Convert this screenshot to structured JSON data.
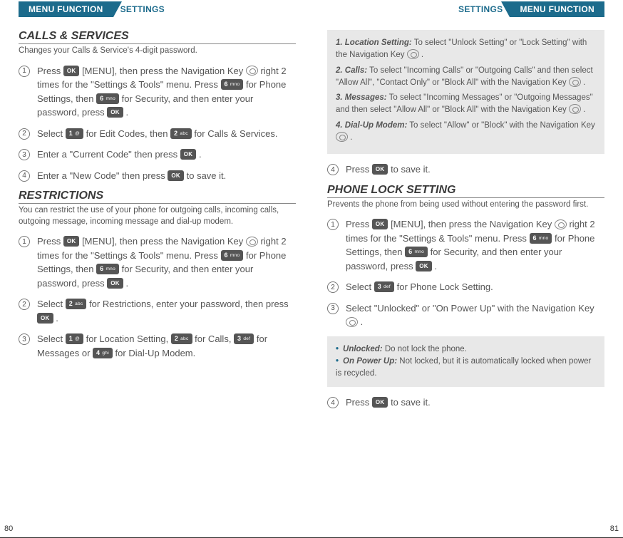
{
  "tabs": {
    "main": "MENU FUNCTION",
    "sub": "SETTINGS"
  },
  "keys": {
    "ok": "OK",
    "k1": {
      "num": "1",
      "lab": "@"
    },
    "k2": {
      "num": "2",
      "lab": "abc"
    },
    "k3": {
      "num": "3",
      "lab": "def"
    },
    "k4": {
      "num": "4",
      "lab": "ghi"
    },
    "k6": {
      "num": "6",
      "lab": "mno"
    }
  },
  "left": {
    "sec1": {
      "title": "CALLS & SERVICES",
      "subtitle": "Changes your Calls & Service's 4-digit password.",
      "steps": {
        "s1a": "Press ",
        "s1b": " [MENU], then press the Navigation Key ",
        "s1c": " right 2 times for the \"Settings & Tools\" menu. Press ",
        "s1d": " for Phone Settings, then ",
        "s1e": " for Security, and then enter your password, press ",
        "s1f": " .",
        "s2a": "Select ",
        "s2b": " for Edit Codes, then ",
        "s2c": " for Calls & Services.",
        "s3a": "Enter a \"Current Code\" then press ",
        "s3b": " .",
        "s4a": "Enter a \"New Code\" then press ",
        "s4b": " to save it."
      }
    },
    "sec2": {
      "title": "RESTRICTIONS",
      "subtitle": "You can restrict the use of your phone for outgoing calls, incoming calls, outgoing message, incoming message and dial-up modem.",
      "steps": {
        "s1a": "Press ",
        "s1b": " [MENU], then press the Navigation Key ",
        "s1c": " right 2 times for the \"Settings & Tools\" menu. Press ",
        "s1d": " for Phone Settings, then ",
        "s1e": " for Security, and then enter your password, press ",
        "s1f": " .",
        "s2a": "Select ",
        "s2b": " for Restrictions, enter your password, then press ",
        "s2c": " .",
        "s3a": "Select ",
        "s3b": " for Location Setting, ",
        "s3c": " for Calls, ",
        "s3d": " for Messages or ",
        "s3e": " for Dial-Up Modem."
      }
    },
    "pagenum": "80"
  },
  "right": {
    "box1": {
      "i1": {
        "label": "1. Location Setting:",
        "text": " To select \"Unlock Setting\" or \"Lock Setting\" with the Navigation Key ",
        "tail": " ."
      },
      "i2": {
        "label": "2. Calls:",
        "text": " To select \"Incoming Calls\" or \"Outgoing Calls\" and then select \"Allow All\", \"Contact Only\" or \"Block All\" with the Navigation Key ",
        "tail": " ."
      },
      "i3": {
        "label": "3. Messages:",
        "text": " To select \"Incoming Messages\" or \"Outgoing Messages\" and then select \"Allow All\" or \"Block All\" with the Navigation Key ",
        "tail": " ."
      },
      "i4": {
        "label": "4. Dial-Up Modem:",
        "text": " To select \"Allow\" or \"Block\" with the Navigation Key ",
        "tail": " ."
      }
    },
    "step4a": "Press ",
    "step4b": " to save it.",
    "sec1": {
      "title": "PHONE LOCK SETTING",
      "subtitle": "Prevents the phone from being used without entering the password first.",
      "steps": {
        "s1a": "Press ",
        "s1b": " [MENU], then press the Navigation Key ",
        "s1c": " right 2 times for the \"Settings & Tools\" menu. Press ",
        "s1d": " for Phone Settings, then ",
        "s1e": " for Security, and then enter your password, press ",
        "s1f": " .",
        "s2a": "Select ",
        "s2b": " for Phone Lock Setting.",
        "s3a": "Select \"Unlocked\" or \"On Power Up\" with the Navigation Key ",
        "s3b": " ."
      }
    },
    "box2": {
      "b1": {
        "label": "Unlocked:",
        "text": " Do not lock the phone."
      },
      "b2": {
        "label": "On Power Up:",
        "text": " Not locked, but it is automatically locked when power is recycled."
      }
    },
    "step4c": "Press ",
    "step4d": " to save it.",
    "pagenum": "81"
  }
}
